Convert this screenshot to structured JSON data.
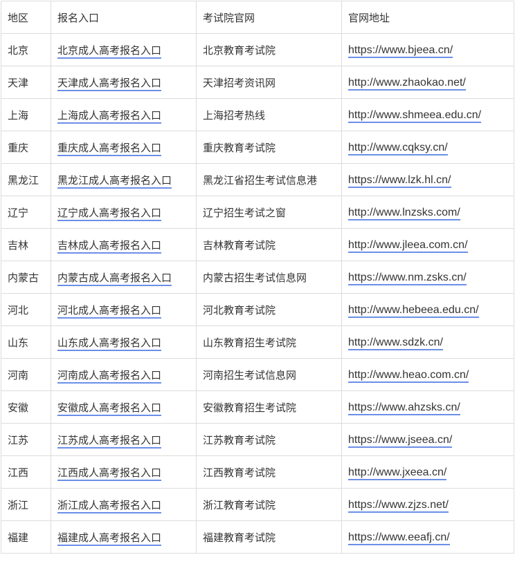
{
  "headers": [
    "地区",
    "报名入口",
    "考试院官网",
    "官网地址"
  ],
  "rows": [
    {
      "region": "北京",
      "entry": "北京成人高考报名入口",
      "office": "北京教育考试院",
      "url": "https://www.bjeea.cn/"
    },
    {
      "region": "天津",
      "entry": "天津成人高考报名入口",
      "office": "天津招考资讯网",
      "url": "http://www.zhaokao.net/"
    },
    {
      "region": "上海",
      "entry": "上海成人高考报名入口",
      "office": "上海招考热线",
      "url": "http://www.shmeea.edu.cn/"
    },
    {
      "region": "重庆",
      "entry": "重庆成人高考报名入口",
      "office": "重庆教育考试院",
      "url": "http://www.cqksy.cn/"
    },
    {
      "region": "黑龙江",
      "entry": "黑龙江成人高考报名入口",
      "office": "黑龙江省招生考试信息港",
      "url": "https://www.lzk.hl.cn/"
    },
    {
      "region": "辽宁",
      "entry": "辽宁成人高考报名入口",
      "office": "辽宁招生考试之窗",
      "url": "http://www.lnzsks.com/"
    },
    {
      "region": "吉林",
      "entry": "吉林成人高考报名入口",
      "office": "吉林教育考试院",
      "url": "http://www.jleea.com.cn/"
    },
    {
      "region": "内蒙古",
      "entry": "内蒙古成人高考报名入口",
      "office": "内蒙古招生考试信息网",
      "url": "https://www.nm.zsks.cn/"
    },
    {
      "region": "河北",
      "entry": "河北成人高考报名入口",
      "office": "河北教育考试院",
      "url": "http://www.hebeea.edu.cn/"
    },
    {
      "region": "山东",
      "entry": "山东成人高考报名入口",
      "office": "山东教育招生考试院",
      "url": "http://www.sdzk.cn/"
    },
    {
      "region": "河南",
      "entry": "河南成人高考报名入口",
      "office": "河南招生考试信息网",
      "url": "http://www.heao.com.cn/"
    },
    {
      "region": "安徽",
      "entry": "安徽成人高考报名入口",
      "office": "安徽教育招生考试院",
      "url": "https://www.ahzsks.cn/"
    },
    {
      "region": "江苏",
      "entry": "江苏成人高考报名入口",
      "office": "江苏教育考试院",
      "url": "https://www.jseea.cn/"
    },
    {
      "region": "江西",
      "entry": "江西成人高考报名入口",
      "office": "江西教育考试院",
      "url": "http://www.jxeea.cn/"
    },
    {
      "region": "浙江",
      "entry": "浙江成人高考报名入口",
      "office": "浙江教育考试院",
      "url": "https://www.zjzs.net/"
    },
    {
      "region": "福建",
      "entry": "福建成人高考报名入口",
      "office": "福建教育考试院",
      "url": "https://www.eeafj.cn/"
    }
  ],
  "colors": {
    "text": "#333333",
    "border": "#dcdcdc",
    "link_underline": "#6b8ee8"
  }
}
